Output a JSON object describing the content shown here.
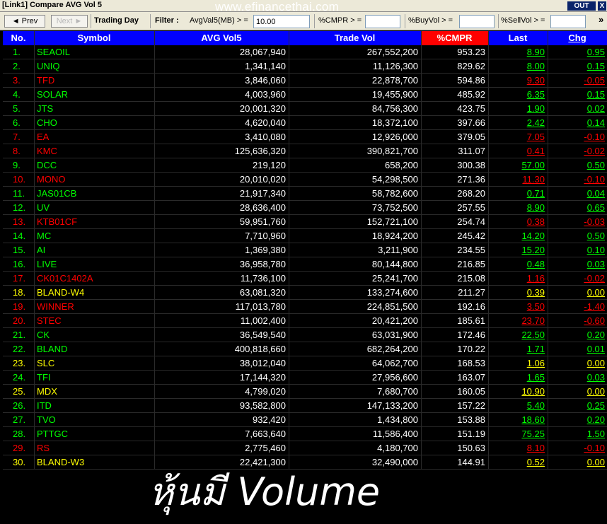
{
  "window": {
    "title": "[Link1] Compare AVG Vol 5",
    "watermark": "www.efinancethai.com",
    "out_label": "OUT",
    "close_label": "X"
  },
  "toolbar": {
    "prev_label": "◄ Prev",
    "next_label": "Next ►",
    "trading_day_label": "Trading Day",
    "filter_label": "Filter :",
    "avgvol_label": "AvgVal5(MB) > =",
    "avgvol_value": "10.00",
    "cmpr_label": "%CMPR > =",
    "cmpr_value": "",
    "buyvol_label": "%BuyVol > =",
    "buyvol_value": "",
    "sellvol_label": "%SellVol > =",
    "sellvol_value": "",
    "more_label": "»"
  },
  "colors": {
    "green": "#00ff00",
    "red": "#ff0000",
    "yellow": "#ffff00",
    "white": "#ffffff",
    "header_bg": "#0000ff",
    "active_header": "#ff0000"
  },
  "table": {
    "headers": {
      "no": "No.",
      "symbol": "Symbol",
      "avg": "AVG Vol5",
      "vol": "Trade Vol",
      "pct": "%CMPR",
      "last": "Last",
      "chg": "Chg"
    },
    "rows": [
      {
        "no": "1.",
        "symbol": "SEAOIL",
        "avg": "28,067,940",
        "vol": "267,552,200",
        "pct": "953.23",
        "last": "8.90",
        "chg": "0.95",
        "color": "green"
      },
      {
        "no": "2.",
        "symbol": "UNIQ",
        "avg": "1,341,140",
        "vol": "11,126,300",
        "pct": "829.62",
        "last": "8.00",
        "chg": "0.15",
        "color": "green"
      },
      {
        "no": "3.",
        "symbol": "TFD",
        "avg": "3,846,060",
        "vol": "22,878,700",
        "pct": "594.86",
        "last": "9.30",
        "chg": "-0.05",
        "color": "red"
      },
      {
        "no": "4.",
        "symbol": "SOLAR",
        "avg": "4,003,960",
        "vol": "19,455,900",
        "pct": "485.92",
        "last": "6.35",
        "chg": "0.15",
        "color": "green"
      },
      {
        "no": "5.",
        "symbol": "JTS",
        "avg": "20,001,320",
        "vol": "84,756,300",
        "pct": "423.75",
        "last": "1.90",
        "chg": "0.02",
        "color": "green"
      },
      {
        "no": "6.",
        "symbol": "CHO",
        "avg": "4,620,040",
        "vol": "18,372,100",
        "pct": "397.66",
        "last": "2.42",
        "chg": "0.14",
        "color": "green"
      },
      {
        "no": "7.",
        "symbol": "EA",
        "avg": "3,410,080",
        "vol": "12,926,000",
        "pct": "379.05",
        "last": "7.05",
        "chg": "-0.10",
        "color": "red"
      },
      {
        "no": "8.",
        "symbol": "KMC",
        "avg": "125,636,320",
        "vol": "390,821,700",
        "pct": "311.07",
        "last": "0.41",
        "chg": "-0.02",
        "color": "red"
      },
      {
        "no": "9.",
        "symbol": "DCC",
        "avg": "219,120",
        "vol": "658,200",
        "pct": "300.38",
        "last": "57.00",
        "chg": "0.50",
        "color": "green"
      },
      {
        "no": "10.",
        "symbol": "MONO",
        "avg": "20,010,020",
        "vol": "54,298,500",
        "pct": "271.36",
        "last": "11.30",
        "chg": "-0.10",
        "color": "red"
      },
      {
        "no": "11.",
        "symbol": "JAS01CB",
        "avg": "21,917,340",
        "vol": "58,782,600",
        "pct": "268.20",
        "last": "0.71",
        "chg": "0.04",
        "color": "green"
      },
      {
        "no": "12.",
        "symbol": "UV",
        "avg": "28,636,400",
        "vol": "73,752,500",
        "pct": "257.55",
        "last": "8.90",
        "chg": "0.65",
        "color": "green"
      },
      {
        "no": "13.",
        "symbol": "KTB01CF",
        "avg": "59,951,760",
        "vol": "152,721,100",
        "pct": "254.74",
        "last": "0.38",
        "chg": "-0.03",
        "color": "red"
      },
      {
        "no": "14.",
        "symbol": "MC",
        "avg": "7,710,960",
        "vol": "18,924,200",
        "pct": "245.42",
        "last": "14.20",
        "chg": "0.50",
        "color": "green"
      },
      {
        "no": "15.",
        "symbol": "AI",
        "avg": "1,369,380",
        "vol": "3,211,900",
        "pct": "234.55",
        "last": "15.20",
        "chg": "0.10",
        "color": "green"
      },
      {
        "no": "16.",
        "symbol": "LIVE",
        "avg": "36,958,780",
        "vol": "80,144,800",
        "pct": "216.85",
        "last": "0.48",
        "chg": "0.03",
        "color": "green"
      },
      {
        "no": "17.",
        "symbol": "CK01C1402A",
        "avg": "11,736,100",
        "vol": "25,241,700",
        "pct": "215.08",
        "last": "1.16",
        "chg": "-0.02",
        "color": "red"
      },
      {
        "no": "18.",
        "symbol": "BLAND-W4",
        "avg": "63,081,320",
        "vol": "133,274,600",
        "pct": "211.27",
        "last": "0.39",
        "chg": "0.00",
        "color": "yellow"
      },
      {
        "no": "19.",
        "symbol": "WINNER",
        "avg": "117,013,780",
        "vol": "224,851,500",
        "pct": "192.16",
        "last": "3.50",
        "chg": "-1.40",
        "color": "red"
      },
      {
        "no": "20.",
        "symbol": "STEC",
        "avg": "11,002,400",
        "vol": "20,421,200",
        "pct": "185.61",
        "last": "23.70",
        "chg": "-0.60",
        "color": "red"
      },
      {
        "no": "21.",
        "symbol": "CK",
        "avg": "36,549,540",
        "vol": "63,031,900",
        "pct": "172.46",
        "last": "22.50",
        "chg": "0.20",
        "color": "green"
      },
      {
        "no": "22.",
        "symbol": "BLAND",
        "avg": "400,818,660",
        "vol": "682,264,200",
        "pct": "170.22",
        "last": "1.71",
        "chg": "0.01",
        "color": "green"
      },
      {
        "no": "23.",
        "symbol": "SLC",
        "avg": "38,012,040",
        "vol": "64,062,700",
        "pct": "168.53",
        "last": "1.06",
        "chg": "0.00",
        "color": "yellow"
      },
      {
        "no": "24.",
        "symbol": "TFI",
        "avg": "17,144,320",
        "vol": "27,956,600",
        "pct": "163.07",
        "last": "1.65",
        "chg": "0.03",
        "color": "green"
      },
      {
        "no": "25.",
        "symbol": "MDX",
        "avg": "4,799,020",
        "vol": "7,680,700",
        "pct": "160.05",
        "last": "10.90",
        "chg": "0.00",
        "color": "yellow"
      },
      {
        "no": "26.",
        "symbol": "ITD",
        "avg": "93,582,800",
        "vol": "147,133,200",
        "pct": "157.22",
        "last": "5.40",
        "chg": "0.25",
        "color": "green"
      },
      {
        "no": "27.",
        "symbol": "TVO",
        "avg": "932,420",
        "vol": "1,434,800",
        "pct": "153.88",
        "last": "18.60",
        "chg": "0.20",
        "color": "green"
      },
      {
        "no": "28.",
        "symbol": "PTTGC",
        "avg": "7,663,640",
        "vol": "11,586,400",
        "pct": "151.19",
        "last": "75.25",
        "chg": "1.50",
        "color": "green"
      },
      {
        "no": "29.",
        "symbol": "RS",
        "avg": "2,775,460",
        "vol": "4,180,700",
        "pct": "150.63",
        "last": "8.10",
        "chg": "-0.10",
        "color": "red"
      },
      {
        "no": "30.",
        "symbol": "BLAND-W3",
        "avg": "22,421,300",
        "vol": "32,490,000",
        "pct": "144.91",
        "last": "0.52",
        "chg": "0.00",
        "color": "yellow"
      }
    ]
  },
  "overlay_text": "หุ้นมี Volume"
}
